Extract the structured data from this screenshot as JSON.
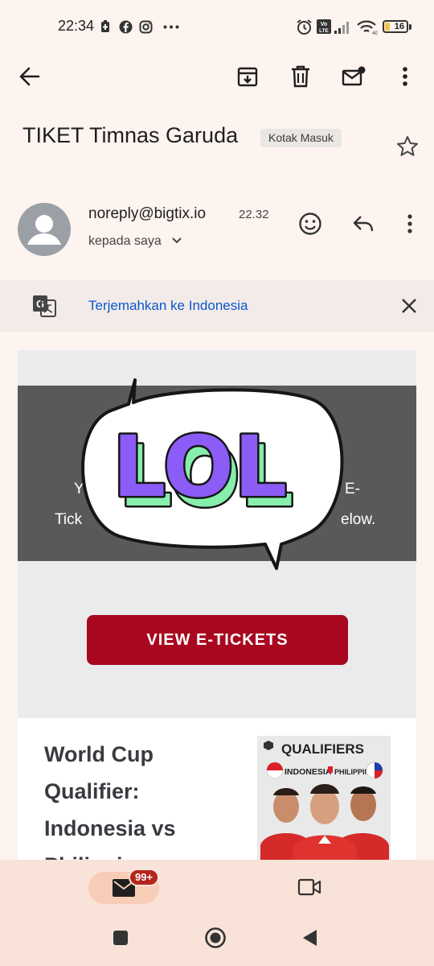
{
  "status_bar": {
    "time": "22:34",
    "battery": "16",
    "network": "4G"
  },
  "toolbar": {
    "back": "arrow-left-icon",
    "archive": "archive-icon",
    "delete": "trash-icon",
    "mark_unread": "mail-unread-icon",
    "more": "more-vert-icon"
  },
  "email": {
    "subject": "TIKET Timnas Garuda",
    "label": "Kotak Masuk",
    "sender": "noreply@bigtix.io",
    "time": "22.32",
    "recipient": "kepada saya"
  },
  "translate": {
    "link": "Terjemahkan ke Indonesia"
  },
  "body": {
    "hero_left_fragment": "Y",
    "hero_right_fragment": "E-",
    "hero_line2_left": "Tick",
    "hero_line2_right": "elow.",
    "button": "VIEW E-TICKETS",
    "card_title": "World Cup Qualifier: Indonesia vs Philippines",
    "poster_heading": "QUALIFIERS",
    "poster_teams_left": "INDONESIA",
    "poster_teams_right": "PHILIPPINES"
  },
  "sticker": {
    "text": "LOL"
  },
  "bottom_nav": {
    "mail_badge": "99+"
  },
  "colors": {
    "accent_red": "#a8081f",
    "link_blue": "#0b57d0",
    "sticker_purple": "#8b5cf6",
    "sticker_green": "#86efac"
  }
}
